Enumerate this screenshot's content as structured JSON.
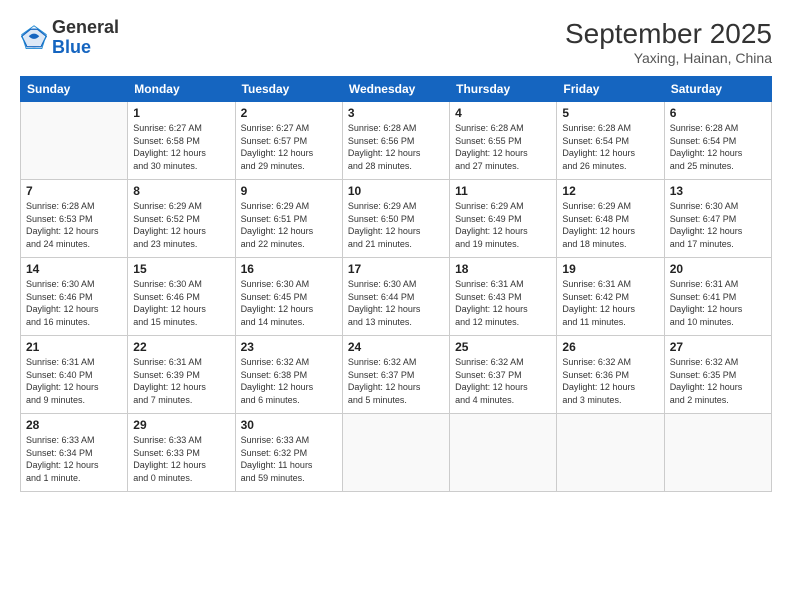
{
  "header": {
    "logo_general": "General",
    "logo_blue": "Blue",
    "month_title": "September 2025",
    "subtitle": "Yaxing, Hainan, China"
  },
  "weekdays": [
    "Sunday",
    "Monday",
    "Tuesday",
    "Wednesday",
    "Thursday",
    "Friday",
    "Saturday"
  ],
  "weeks": [
    [
      {
        "day": "",
        "text": ""
      },
      {
        "day": "1",
        "text": "Sunrise: 6:27 AM\nSunset: 6:58 PM\nDaylight: 12 hours\nand 30 minutes."
      },
      {
        "day": "2",
        "text": "Sunrise: 6:27 AM\nSunset: 6:57 PM\nDaylight: 12 hours\nand 29 minutes."
      },
      {
        "day": "3",
        "text": "Sunrise: 6:28 AM\nSunset: 6:56 PM\nDaylight: 12 hours\nand 28 minutes."
      },
      {
        "day": "4",
        "text": "Sunrise: 6:28 AM\nSunset: 6:55 PM\nDaylight: 12 hours\nand 27 minutes."
      },
      {
        "day": "5",
        "text": "Sunrise: 6:28 AM\nSunset: 6:54 PM\nDaylight: 12 hours\nand 26 minutes."
      },
      {
        "day": "6",
        "text": "Sunrise: 6:28 AM\nSunset: 6:54 PM\nDaylight: 12 hours\nand 25 minutes."
      }
    ],
    [
      {
        "day": "7",
        "text": "Sunrise: 6:28 AM\nSunset: 6:53 PM\nDaylight: 12 hours\nand 24 minutes."
      },
      {
        "day": "8",
        "text": "Sunrise: 6:29 AM\nSunset: 6:52 PM\nDaylight: 12 hours\nand 23 minutes."
      },
      {
        "day": "9",
        "text": "Sunrise: 6:29 AM\nSunset: 6:51 PM\nDaylight: 12 hours\nand 22 minutes."
      },
      {
        "day": "10",
        "text": "Sunrise: 6:29 AM\nSunset: 6:50 PM\nDaylight: 12 hours\nand 21 minutes."
      },
      {
        "day": "11",
        "text": "Sunrise: 6:29 AM\nSunset: 6:49 PM\nDaylight: 12 hours\nand 19 minutes."
      },
      {
        "day": "12",
        "text": "Sunrise: 6:29 AM\nSunset: 6:48 PM\nDaylight: 12 hours\nand 18 minutes."
      },
      {
        "day": "13",
        "text": "Sunrise: 6:30 AM\nSunset: 6:47 PM\nDaylight: 12 hours\nand 17 minutes."
      }
    ],
    [
      {
        "day": "14",
        "text": "Sunrise: 6:30 AM\nSunset: 6:46 PM\nDaylight: 12 hours\nand 16 minutes."
      },
      {
        "day": "15",
        "text": "Sunrise: 6:30 AM\nSunset: 6:46 PM\nDaylight: 12 hours\nand 15 minutes."
      },
      {
        "day": "16",
        "text": "Sunrise: 6:30 AM\nSunset: 6:45 PM\nDaylight: 12 hours\nand 14 minutes."
      },
      {
        "day": "17",
        "text": "Sunrise: 6:30 AM\nSunset: 6:44 PM\nDaylight: 12 hours\nand 13 minutes."
      },
      {
        "day": "18",
        "text": "Sunrise: 6:31 AM\nSunset: 6:43 PM\nDaylight: 12 hours\nand 12 minutes."
      },
      {
        "day": "19",
        "text": "Sunrise: 6:31 AM\nSunset: 6:42 PM\nDaylight: 12 hours\nand 11 minutes."
      },
      {
        "day": "20",
        "text": "Sunrise: 6:31 AM\nSunset: 6:41 PM\nDaylight: 12 hours\nand 10 minutes."
      }
    ],
    [
      {
        "day": "21",
        "text": "Sunrise: 6:31 AM\nSunset: 6:40 PM\nDaylight: 12 hours\nand 9 minutes."
      },
      {
        "day": "22",
        "text": "Sunrise: 6:31 AM\nSunset: 6:39 PM\nDaylight: 12 hours\nand 7 minutes."
      },
      {
        "day": "23",
        "text": "Sunrise: 6:32 AM\nSunset: 6:38 PM\nDaylight: 12 hours\nand 6 minutes."
      },
      {
        "day": "24",
        "text": "Sunrise: 6:32 AM\nSunset: 6:37 PM\nDaylight: 12 hours\nand 5 minutes."
      },
      {
        "day": "25",
        "text": "Sunrise: 6:32 AM\nSunset: 6:37 PM\nDaylight: 12 hours\nand 4 minutes."
      },
      {
        "day": "26",
        "text": "Sunrise: 6:32 AM\nSunset: 6:36 PM\nDaylight: 12 hours\nand 3 minutes."
      },
      {
        "day": "27",
        "text": "Sunrise: 6:32 AM\nSunset: 6:35 PM\nDaylight: 12 hours\nand 2 minutes."
      }
    ],
    [
      {
        "day": "28",
        "text": "Sunrise: 6:33 AM\nSunset: 6:34 PM\nDaylight: 12 hours\nand 1 minute."
      },
      {
        "day": "29",
        "text": "Sunrise: 6:33 AM\nSunset: 6:33 PM\nDaylight: 12 hours\nand 0 minutes."
      },
      {
        "day": "30",
        "text": "Sunrise: 6:33 AM\nSunset: 6:32 PM\nDaylight: 11 hours\nand 59 minutes."
      },
      {
        "day": "",
        "text": ""
      },
      {
        "day": "",
        "text": ""
      },
      {
        "day": "",
        "text": ""
      },
      {
        "day": "",
        "text": ""
      }
    ]
  ]
}
